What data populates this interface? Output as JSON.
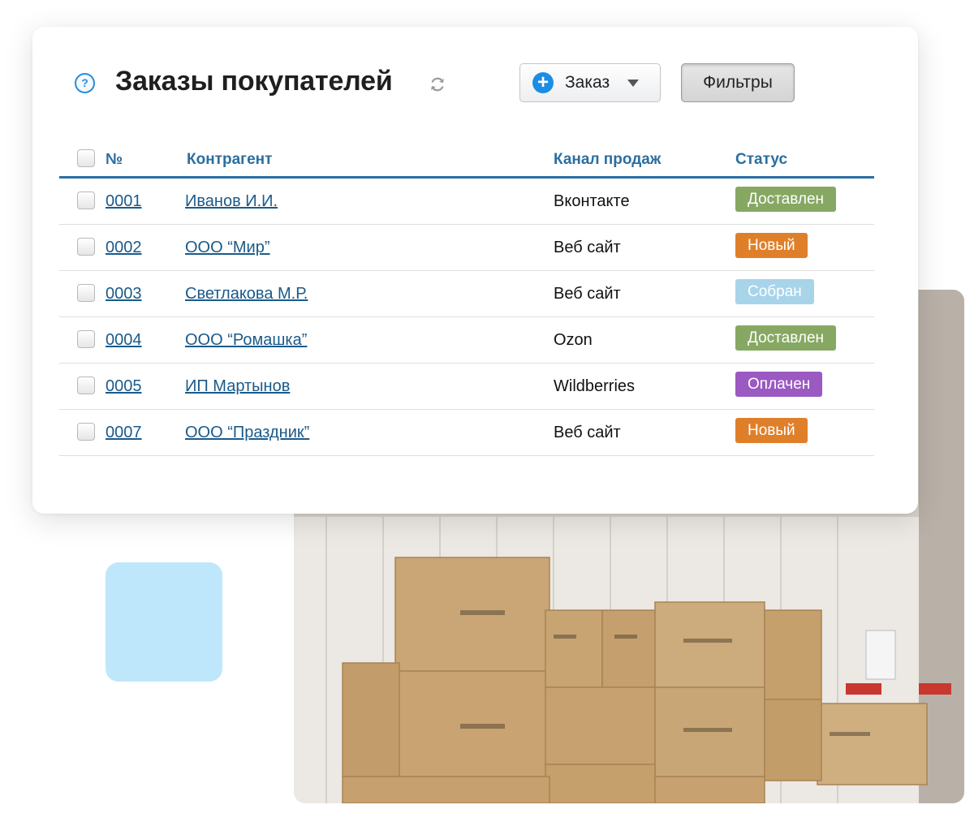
{
  "header": {
    "title": "Заказы покупателей",
    "help_icon": "question-circle-icon",
    "refresh_icon": "refresh-icon"
  },
  "toolbar": {
    "order_button_label": "Заказ",
    "filters_button_label": "Фильтры"
  },
  "table": {
    "columns": [
      "№",
      "Контрагент",
      "Канал продаж",
      "Статус"
    ],
    "rows": [
      {
        "number": "0001",
        "counterparty": "Иванов И.И.",
        "channel": "Вконтакте",
        "status": "Доставлен",
        "status_color": "#86a862"
      },
      {
        "number": "0002",
        "counterparty": "ООО “Мир”",
        "channel": "Веб сайт",
        "status": "Новый",
        "status_color": "#e07f2a"
      },
      {
        "number": "0003",
        "counterparty": "Светлакова М.Р.",
        "channel": "Веб сайт",
        "status": "Собран",
        "status_color": "#a8d4ea"
      },
      {
        "number": "0004",
        "counterparty": "ООО “Ромашка”",
        "channel": "Ozon",
        "status": "Доставлен",
        "status_color": "#86a862"
      },
      {
        "number": "0005",
        "counterparty": "ИП Мартынов",
        "channel": "Wildberries",
        "status": "Оплачен",
        "status_color": "#9b59c2"
      },
      {
        "number": "0007",
        "counterparty": "ООО “Праздник”",
        "channel": "Веб сайт",
        "status": "Новый",
        "status_color": "#e07f2a"
      }
    ]
  },
  "colors": {
    "accent": "#2b6ea0",
    "link": "#1a5a8a",
    "decor_square": "#bfe7fb"
  }
}
